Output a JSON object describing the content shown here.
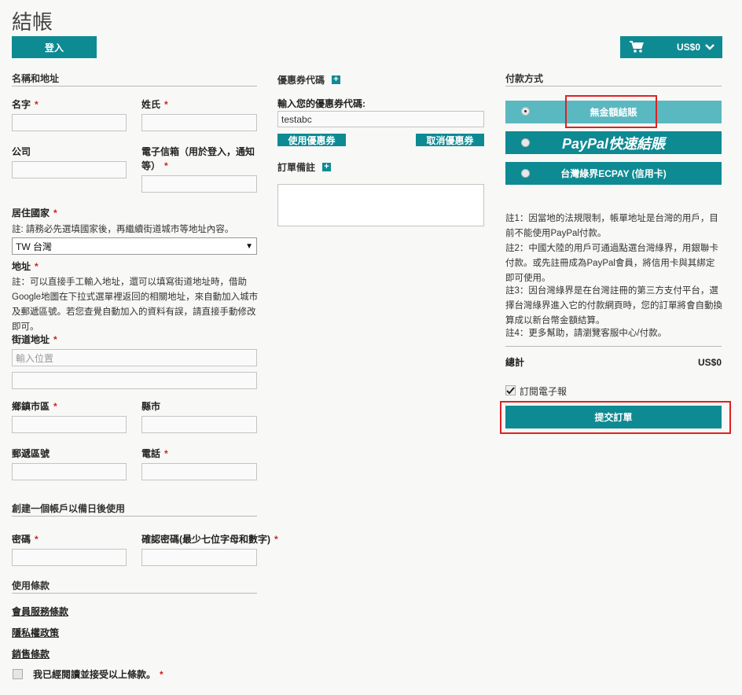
{
  "page": {
    "title": "結帳"
  },
  "header": {
    "login_label": "登入",
    "cart_amount": "US$0"
  },
  "address": {
    "section_title": "名稱和地址",
    "first_name_label": "名字",
    "last_name_label": "姓氏",
    "company_label": "公司",
    "email_label": "電子信箱（用於登入，通知等）",
    "country_label": "居住國家",
    "country_note": "註: 請務必先選填國家後，再繼續街道城市等地址內容。",
    "country_value": "TW 台灣",
    "address_label": "地址",
    "address_note": "註：可以直接手工輸入地址，還可以填寫街道地址時，借助Google地圖在下拉式選單裡返回的相關地址，來自動加入城市及郵遞區號。若您查覺自動加入的資料有誤，請直接手動修改即可。",
    "street_label": "街道地址",
    "street_placeholder": "輸入位置",
    "district_label": "鄉鎮市區",
    "city_label": "縣市",
    "postcode_label": "郵遞區號",
    "phone_label": "電話",
    "required_mark": "*"
  },
  "account": {
    "section_title": "創建一個帳戶以備日後使用",
    "password_label": "密碼",
    "confirm_label": "確認密碼(最少七位字母和數字)"
  },
  "terms": {
    "section_title": "使用條款",
    "links": [
      "會員服務條款",
      "隱私權政策",
      "銷售條款"
    ],
    "agree_label": "我已經閱讀並接受以上條款。"
  },
  "coupon": {
    "section_title": "優惠券代碼",
    "input_label": "輸入您的優惠券代碼:",
    "input_value": "testabc",
    "apply_label": "使用優惠券",
    "cancel_label": "取消優惠券",
    "notes_title": "訂單備註"
  },
  "payment": {
    "section_title": "付款方式",
    "options": [
      "無金額結賬",
      "PayPal快速結賬",
      "台灣綠界ECPAY (信用卡)"
    ],
    "selected_index": 0,
    "notes": [
      "註1：因當地的法規限制，帳單地址是台灣的用戶，目前不能使用PayPal付款。",
      "註2：中國大陸的用戶可通過點選台灣綠界，用銀聯卡付款。或先註冊成為PayPal會員，將信用卡與其綁定即可使用。",
      "註3：因台灣綠界是在台灣註冊的第三方支付平台，選擇台灣綠界進入它的付款網頁時，您的訂單將會自動換算成以新台幣金額結算。",
      "註4：更多幫助，請瀏覽客服中心/付款。"
    ],
    "total_label": "總計",
    "total_value": "US$0",
    "newsletter_label": "訂閱電子報",
    "newsletter_checked": true,
    "submit_label": "提交訂單"
  },
  "colors": {
    "accent": "#0e8a93",
    "selected": "#5ab8c1",
    "highlight": "#dd2222"
  }
}
